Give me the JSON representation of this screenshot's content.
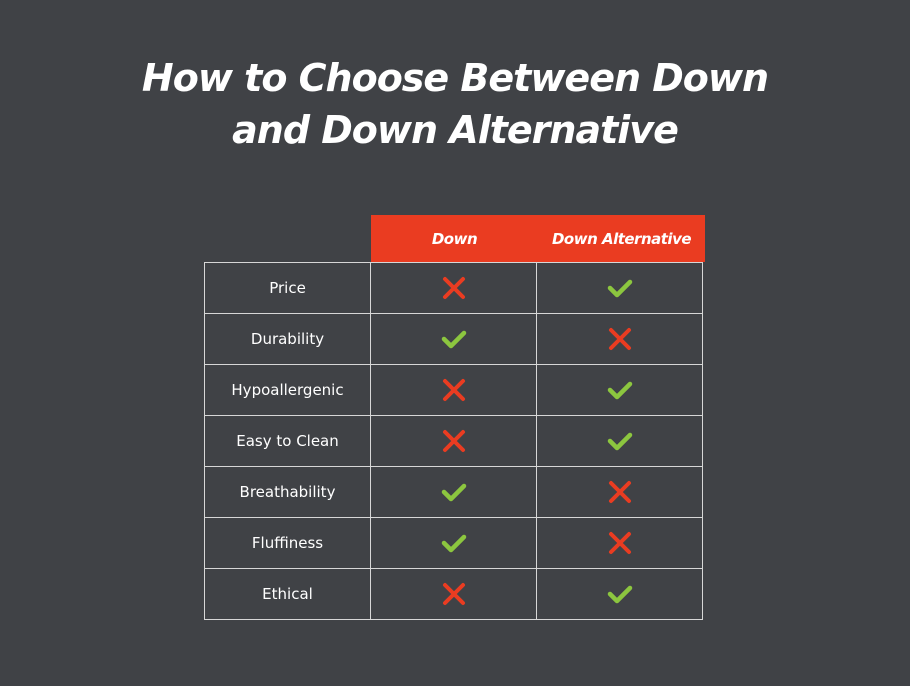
{
  "title": {
    "line1": "How to Choose Between Down",
    "line2": "and Down Alternative"
  },
  "columns": [
    "Down",
    "Down Alternative"
  ],
  "colors": {
    "header": "#ea3c21",
    "check": "#8cc63f",
    "cross": "#ea3c21",
    "background": "#404246"
  },
  "rows": [
    {
      "label": "Price",
      "values": [
        "cross-icon",
        "check-icon"
      ]
    },
    {
      "label": "Durability",
      "values": [
        "check-icon",
        "cross-icon"
      ]
    },
    {
      "label": "Hypoallergenic",
      "values": [
        "cross-icon",
        "check-icon"
      ]
    },
    {
      "label": "Easy to Clean",
      "values": [
        "cross-icon",
        "check-icon"
      ]
    },
    {
      "label": "Breathability",
      "values": [
        "check-icon",
        "cross-icon"
      ]
    },
    {
      "label": "Fluffiness",
      "values": [
        "check-icon",
        "cross-icon"
      ]
    },
    {
      "label": "Ethical",
      "values": [
        "cross-icon",
        "check-icon"
      ]
    }
  ]
}
